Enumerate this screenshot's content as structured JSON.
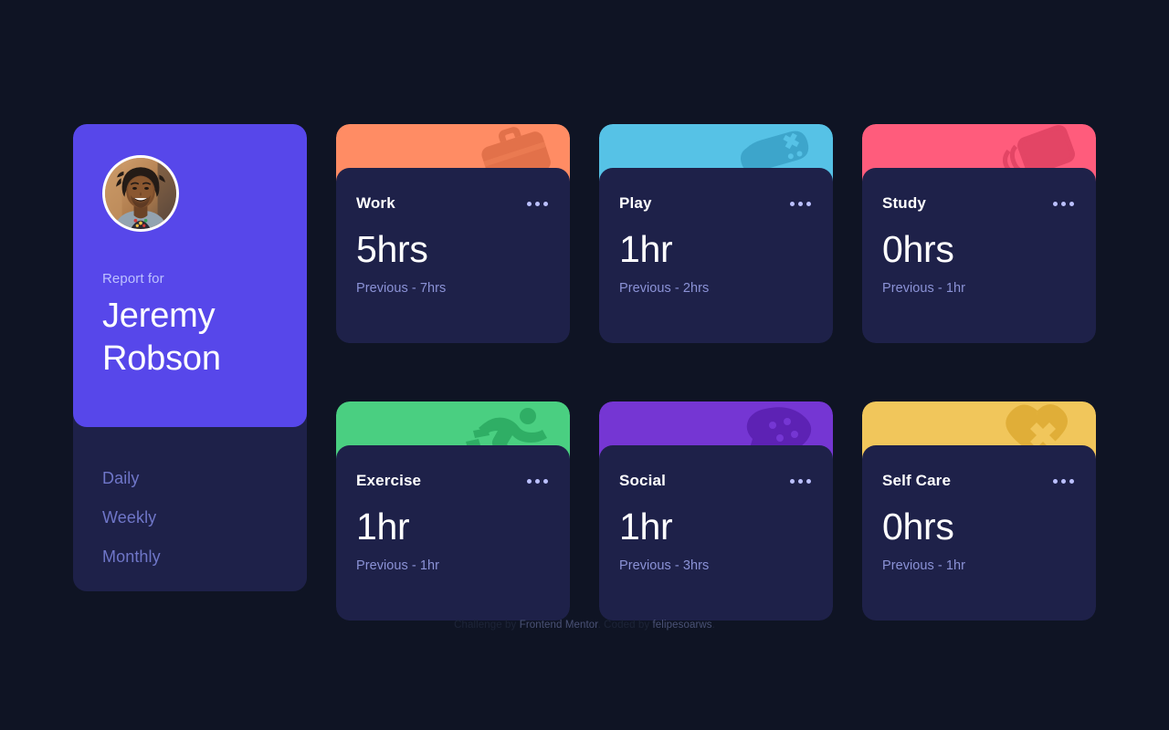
{
  "theme": {
    "background": "#0f1424",
    "card_body": "#1e2149",
    "profile_purple": "#5747ea",
    "text_primary": "#ffffff",
    "text_muted": "#8b92d6",
    "nav_muted": "#6f76c8"
  },
  "profile": {
    "avatar_icon": "user-avatar-photo",
    "report_label": "Report for",
    "name_line1": "Jeremy",
    "name_line2": "Robson",
    "nav": [
      {
        "id": "daily",
        "label": "Daily"
      },
      {
        "id": "weekly",
        "label": "Weekly"
      },
      {
        "id": "monthly",
        "label": "Monthly"
      }
    ]
  },
  "cards": [
    {
      "id": "work",
      "title": "Work",
      "hours": "5hrs",
      "previous": "Previous - 7hrs",
      "accent_color": "#ff8c64",
      "icon_color": "#e2714a",
      "icon": "briefcase-icon",
      "menu_icon": "ellipsis-icon"
    },
    {
      "id": "play",
      "title": "Play",
      "hours": "1hr",
      "previous": "Previous - 2hrs",
      "accent_color": "#56c2e6",
      "icon_color": "#3da5cb",
      "icon": "game-controller-icon",
      "menu_icon": "ellipsis-icon"
    },
    {
      "id": "study",
      "title": "Study",
      "hours": "0hrs",
      "previous": "Previous - 1hr",
      "accent_color": "#ff5c7c",
      "icon_color": "#e34565",
      "icon": "books-icon",
      "menu_icon": "ellipsis-icon"
    },
    {
      "id": "exercise",
      "title": "Exercise",
      "hours": "1hr",
      "previous": "Previous - 1hr",
      "accent_color": "#4acf81",
      "icon_color": "#2fae65",
      "icon": "running-person-icon",
      "menu_icon": "ellipsis-icon"
    },
    {
      "id": "social",
      "title": "Social",
      "hours": "1hr",
      "previous": "Previous - 3hrs",
      "accent_color": "#7536d3",
      "icon_color": "#5d22b4",
      "icon": "speech-bubbles-icon",
      "menu_icon": "ellipsis-icon"
    },
    {
      "id": "self-care",
      "title": "Self Care",
      "hours": "0hrs",
      "previous": "Previous - 1hr",
      "accent_color": "#f1c65b",
      "icon_color": "#e0ae38",
      "icon": "hearts-icon",
      "menu_icon": "ellipsis-icon"
    }
  ],
  "attribution": {
    "challenge_prefix": "Challenge by",
    "challenge_link": "Frontend Mentor",
    "coded_prefix": ". Coded by",
    "coded_link": "felipesoarws",
    "suffix": "."
  }
}
